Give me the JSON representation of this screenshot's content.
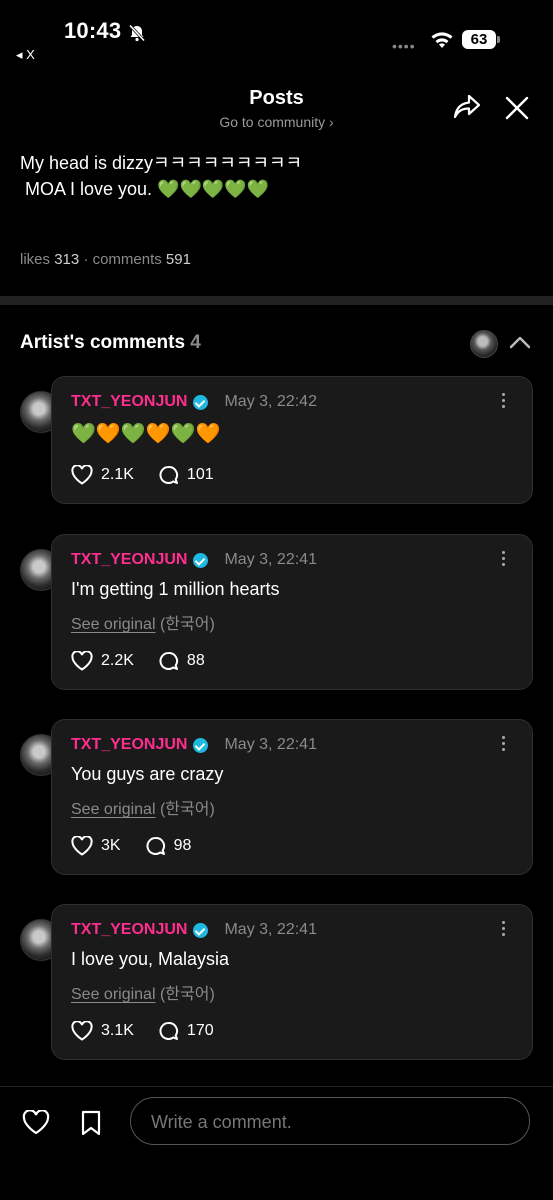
{
  "status_bar": {
    "time": "10:43",
    "back_app": "◂ X",
    "battery": "63"
  },
  "header": {
    "title": "Posts",
    "subtitle": "Go to community ›"
  },
  "post": {
    "text": "My head is dizzyㅋㅋㅋㅋㅋㅋㅋㅋㅋ\n MOA I love you. 💚💚💚💚💚",
    "likes_label": "likes",
    "likes": "313",
    "comments_label": "comments",
    "comments": "591"
  },
  "artist_comments": {
    "title": "Artist's comments",
    "count": "4",
    "items": [
      {
        "author": "TXT_YEONJUN",
        "date": "May 3, 22:42",
        "text": "💚🧡💚🧡💚🧡",
        "see_original": "",
        "lang": "",
        "likes": "2.1K",
        "replies": "101"
      },
      {
        "author": "TXT_YEONJUN",
        "date": "May 3, 22:41",
        "text": "I'm getting 1 million hearts",
        "see_original": "See original",
        "lang": "(한국어)",
        "likes": "2.2K",
        "replies": "88"
      },
      {
        "author": "TXT_YEONJUN",
        "date": "May 3, 22:41",
        "text": "You guys are crazy",
        "see_original": "See original",
        "lang": "(한국어)",
        "likes": "3K",
        "replies": "98"
      },
      {
        "author": "TXT_YEONJUN",
        "date": "May 3, 22:41",
        "text": "I love you, Malaysia",
        "see_original": "See original",
        "lang": "(한국어)",
        "likes": "3.1K",
        "replies": "170"
      }
    ]
  },
  "composer": {
    "placeholder": "Write a comment."
  },
  "icons": {
    "bell": "bell-slash-icon",
    "wifi": "wifi-icon",
    "share": "share-icon",
    "close": "close-icon",
    "chevron": "chevron-up-icon",
    "heart": "heart-icon",
    "comment": "comment-bubble-icon",
    "bookmark": "bookmark-icon",
    "verified": "verified-badge-icon",
    "more": "more-vertical-icon"
  },
  "colors": {
    "author": "#ff2d8f",
    "verified": "#1fb8e0",
    "background": "#000000",
    "card": "#1a1a1a"
  }
}
